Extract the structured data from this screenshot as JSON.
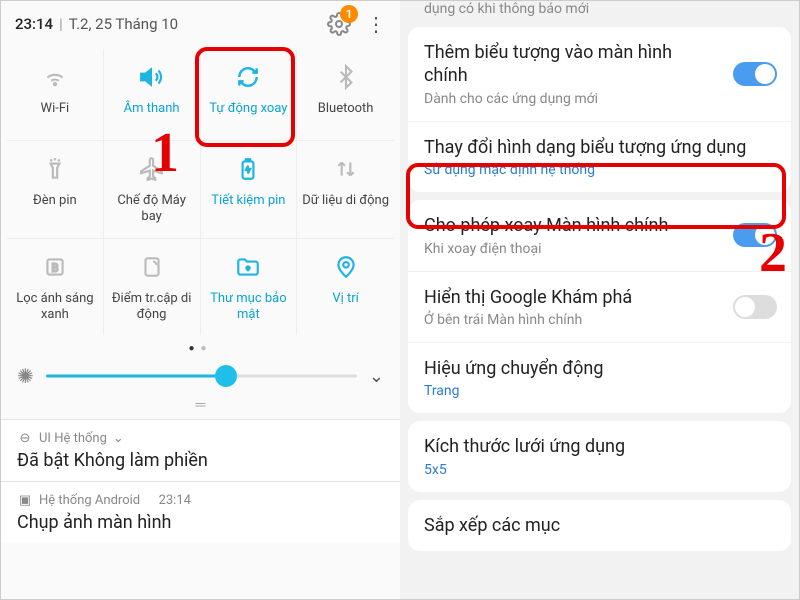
{
  "status": {
    "time": "23:14",
    "separator": "|",
    "date": "T.2, 25 Tháng 10",
    "badge": "1"
  },
  "qs": [
    {
      "label": "Wi-Fi",
      "icon": "wifi",
      "active": false
    },
    {
      "label": "Âm thanh",
      "icon": "sound",
      "active": true
    },
    {
      "label": "Tự động xoay",
      "icon": "rotate",
      "active": true
    },
    {
      "label": "Bluetooth",
      "icon": "bluetooth",
      "active": false
    },
    {
      "label": "Đèn pin",
      "icon": "flashlight",
      "active": false
    },
    {
      "label": "Chế độ Máy bay",
      "icon": "airplane",
      "active": false
    },
    {
      "label": "Tiết kiệm pin",
      "icon": "battery",
      "active": true
    },
    {
      "label": "Dữ liệu di động",
      "icon": "data",
      "active": false
    },
    {
      "label": "Lọc ánh sáng xanh",
      "icon": "bluelight",
      "active": false
    },
    {
      "label": "Điểm tr.cập di động",
      "icon": "hotspot",
      "active": false
    },
    {
      "label": "Thư mục bảo mật",
      "icon": "secure",
      "active": true
    },
    {
      "label": "Vị trí",
      "icon": "location",
      "active": true
    }
  ],
  "notif1": {
    "source": "UI Hệ thống",
    "title": "Đã bật Không làm phiền"
  },
  "notif2": {
    "source": "Hệ thống Android",
    "time": "23:14",
    "title": "Chụp ảnh màn hình"
  },
  "right_cutoff": "dụng có khi thông báo mới",
  "settings": [
    {
      "title": "Thêm biểu tượng vào màn hình chính",
      "sub": "Dành cho các ứng dụng mới",
      "toggle": "on"
    },
    {
      "title": "Thay đổi hình dạng biểu tượng ứng dụng",
      "sub": "Sử dụng mặc định hệ thống",
      "subclass": "blue"
    },
    {
      "title": "Cho phép xoay Màn hình chính",
      "sub": "Khi xoay điện thoại",
      "toggle": "on"
    },
    {
      "title": "Hiển thị Google Khám phá",
      "sub": "Ở bên trái Màn hình chính",
      "toggle": "off"
    },
    {
      "title": "Hiệu ứng chuyển động",
      "sub": "Trang",
      "subclass": "blue"
    },
    {
      "title": "Kích thước lưới ứng dụng",
      "sub": "5x5",
      "subclass": "blue"
    },
    {
      "title": "Sắp xếp các mục"
    }
  ],
  "markers": {
    "one": "1",
    "two": "2"
  }
}
